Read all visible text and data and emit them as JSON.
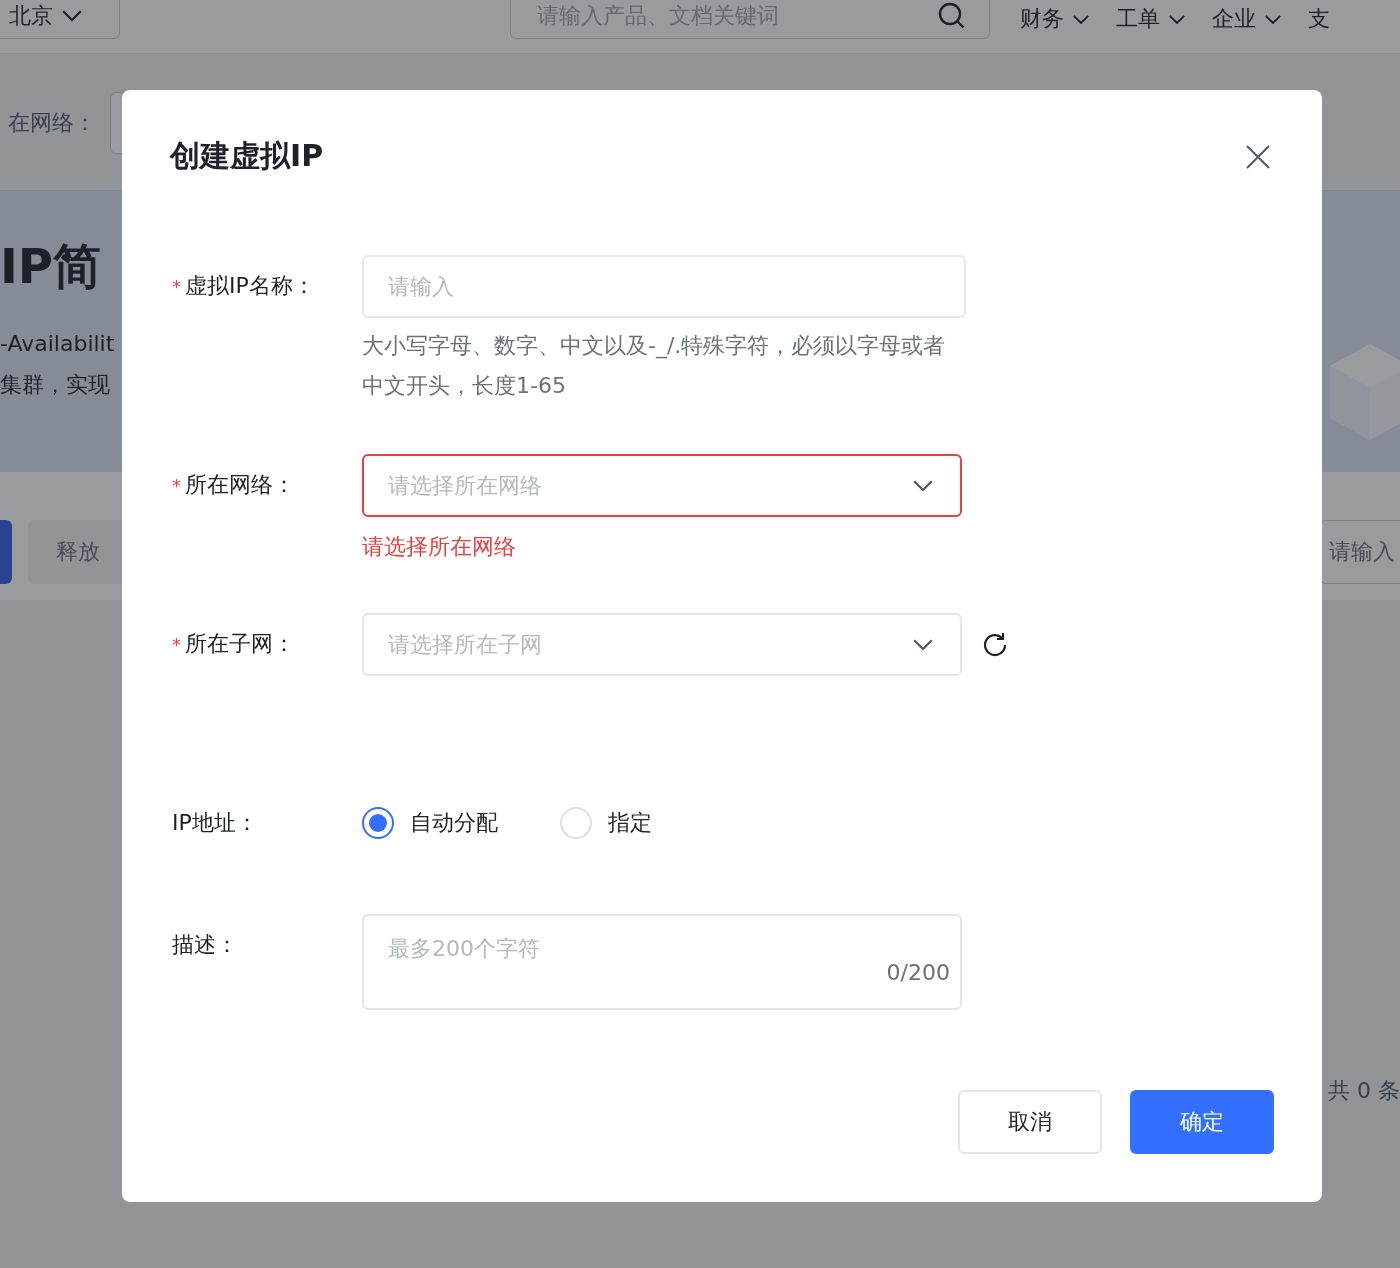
{
  "topbar": {
    "region": {
      "label": "北京"
    },
    "search": {
      "placeholder": "请输入产品、文档关键词"
    },
    "menus": [
      {
        "label": "财务",
        "kind": "menu"
      },
      {
        "label": "工单",
        "kind": "menu"
      },
      {
        "label": "企业",
        "kind": "menu"
      },
      {
        "label": "支",
        "kind": "cut"
      }
    ]
  },
  "filter": {
    "label": "在网络："
  },
  "banner": {
    "title": "IP简",
    "lines": [
      "-Availabilit",
      "集群，实现"
    ]
  },
  "actions": {
    "release_button": {
      "label": "释放",
      "disabled": true
    },
    "search": {
      "placeholder": "请输入"
    }
  },
  "footer": {
    "total": "共 0 条"
  },
  "dialog": {
    "title": "创建虚拟IP",
    "fields": [
      {
        "kind": "text",
        "label": "虚拟IP名称：",
        "required_mark": "*",
        "placeholder": "请输入",
        "help": "大小写字母、数字、中文以及-_/.特殊字符，必须以字母或者中文开头，长度1-65"
      },
      {
        "kind": "select",
        "label": "所在网络：",
        "required_mark": "*",
        "placeholder": "请选择所在网络",
        "error": "请选择所在网络"
      },
      {
        "kind": "select",
        "label": "所在子网：",
        "required_mark": "*",
        "placeholder": "请选择所在子网",
        "refresh": true
      },
      {
        "kind": "radio",
        "label": "IP地址：",
        "options": [
          {
            "label": "自动分配",
            "selected": true
          },
          {
            "label": "指定",
            "selected": false
          }
        ]
      },
      {
        "kind": "textarea",
        "label": "描述：",
        "placeholder": "最多200个字符",
        "counter": "0/200"
      }
    ],
    "buttons": [
      {
        "label": "取消",
        "kind": "secondary"
      },
      {
        "label": "确定",
        "kind": "primary"
      }
    ]
  }
}
